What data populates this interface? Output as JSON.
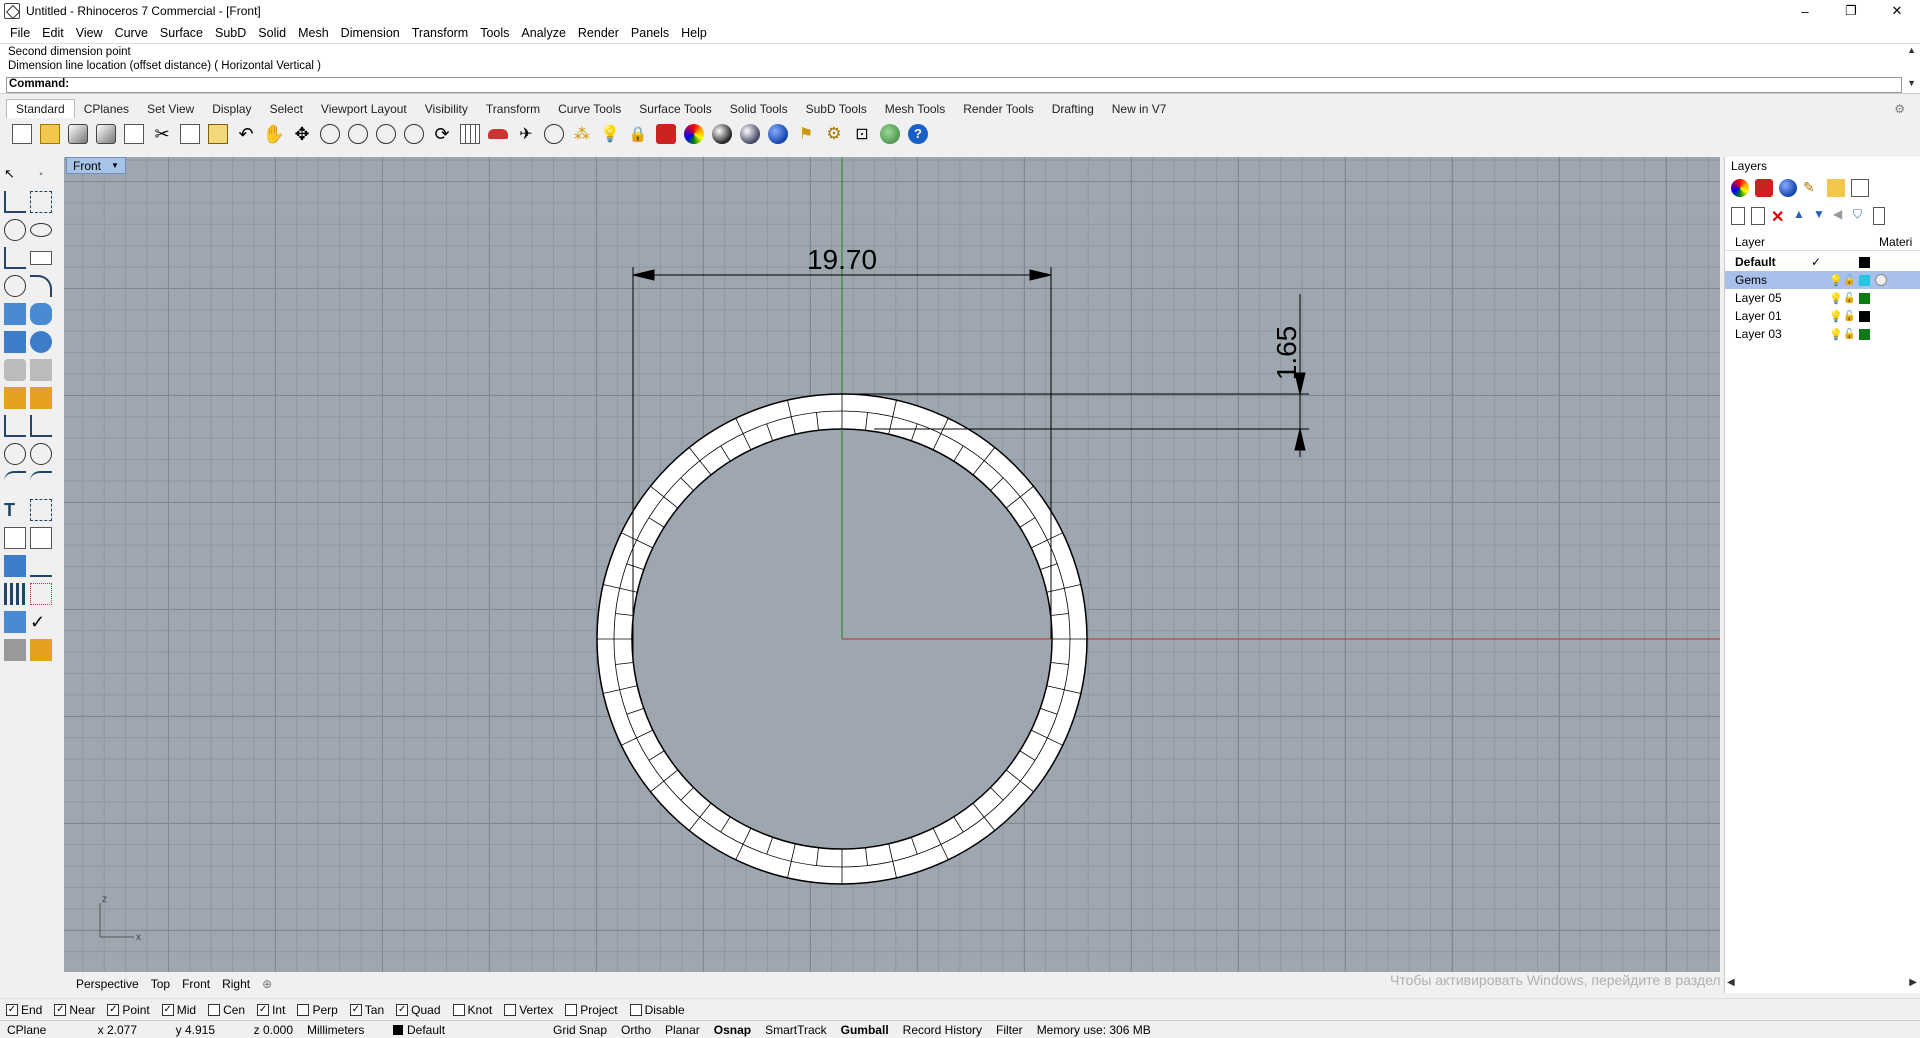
{
  "window": {
    "title": "Untitled - Rhinoceros 7 Commercial - [Front]",
    "minimize": "–",
    "maximize": "❐",
    "close": "✕"
  },
  "menu": [
    "File",
    "Edit",
    "View",
    "Curve",
    "Surface",
    "SubD",
    "Solid",
    "Mesh",
    "Dimension",
    "Transform",
    "Tools",
    "Analyze",
    "Render",
    "Panels",
    "Help"
  ],
  "command": {
    "history": [
      "Second dimension point",
      "Dimension line location (offset distance) ( Horizontal  Vertical )"
    ],
    "prompt": "Command:"
  },
  "toolbar_tabs": [
    "Standard",
    "CPlanes",
    "Set View",
    "Display",
    "Select",
    "Viewport Layout",
    "Visibility",
    "Transform",
    "Curve Tools",
    "Surface Tools",
    "Solid Tools",
    "SubD Tools",
    "Mesh Tools",
    "Render Tools",
    "Drafting",
    "New in V7"
  ],
  "toolbar_icons": [
    "new-icon",
    "open-icon",
    "save-icon",
    "print-icon",
    "import-icon",
    "cut-icon",
    "copy-icon",
    "paste-icon",
    "undo-icon",
    "pan-icon",
    "move-view-icon",
    "zoom-icon",
    "zoom-window-icon",
    "zoom-extents-icon",
    "zoom-selected-icon",
    "rotate-view-icon",
    "grid-icon",
    "car-icon",
    "plane-icon",
    "circle-target-icon",
    "points-icon",
    "light-bulb-icon",
    "lock-icon",
    "layer-icon",
    "color-wheel-icon",
    "render-sphere-icon",
    "gray-sphere-icon",
    "blue-sphere-icon",
    "filter-icon",
    "gear-icon",
    "dimension-icon",
    "globe-icon",
    "help-icon"
  ],
  "viewport": {
    "active": "Front",
    "tabs": [
      "Perspective",
      "Top",
      "Front",
      "Right"
    ],
    "dimension_width": "19.70",
    "dimension_thickness": "1.65",
    "axis_z": "z",
    "axis_x": "x"
  },
  "watermark": "Чтобы активировать Windows, перейдите в раздел \"Параметры\".",
  "osnap": [
    {
      "label": "End",
      "checked": true
    },
    {
      "label": "Near",
      "checked": true
    },
    {
      "label": "Point",
      "checked": true
    },
    {
      "label": "Mid",
      "checked": true
    },
    {
      "label": "Cen",
      "checked": false
    },
    {
      "label": "Int",
      "checked": true
    },
    {
      "label": "Perp",
      "checked": false
    },
    {
      "label": "Tan",
      "checked": true
    },
    {
      "label": "Quad",
      "checked": true
    },
    {
      "label": "Knot",
      "checked": false
    },
    {
      "label": "Vertex",
      "checked": false
    },
    {
      "label": "Project",
      "checked": false
    },
    {
      "label": "Disable",
      "checked": false
    }
  ],
  "status": {
    "cplane": "CPlane",
    "x": "x 2.077",
    "y": "y 4.915",
    "z": "z 0.000",
    "units": "Millimeters",
    "layer": "Default",
    "toggles": [
      "Grid Snap",
      "Ortho",
      "Planar",
      "Osnap",
      "SmartTrack",
      "Gumball",
      "Record History",
      "Filter"
    ],
    "memory": "Memory use: 306 MB"
  },
  "layers_panel": {
    "title": "Layers",
    "col_layer": "Layer",
    "col_material": "Materi",
    "layers": [
      {
        "name": "Default",
        "color": "#000000",
        "current": true
      },
      {
        "name": "Gems",
        "color": "#26c6e0",
        "selected": true
      },
      {
        "name": "Layer 05",
        "color": "#0a7a12"
      },
      {
        "name": "Layer 01",
        "color": "#000000"
      },
      {
        "name": "Layer 03",
        "color": "#0a7a12"
      }
    ]
  }
}
